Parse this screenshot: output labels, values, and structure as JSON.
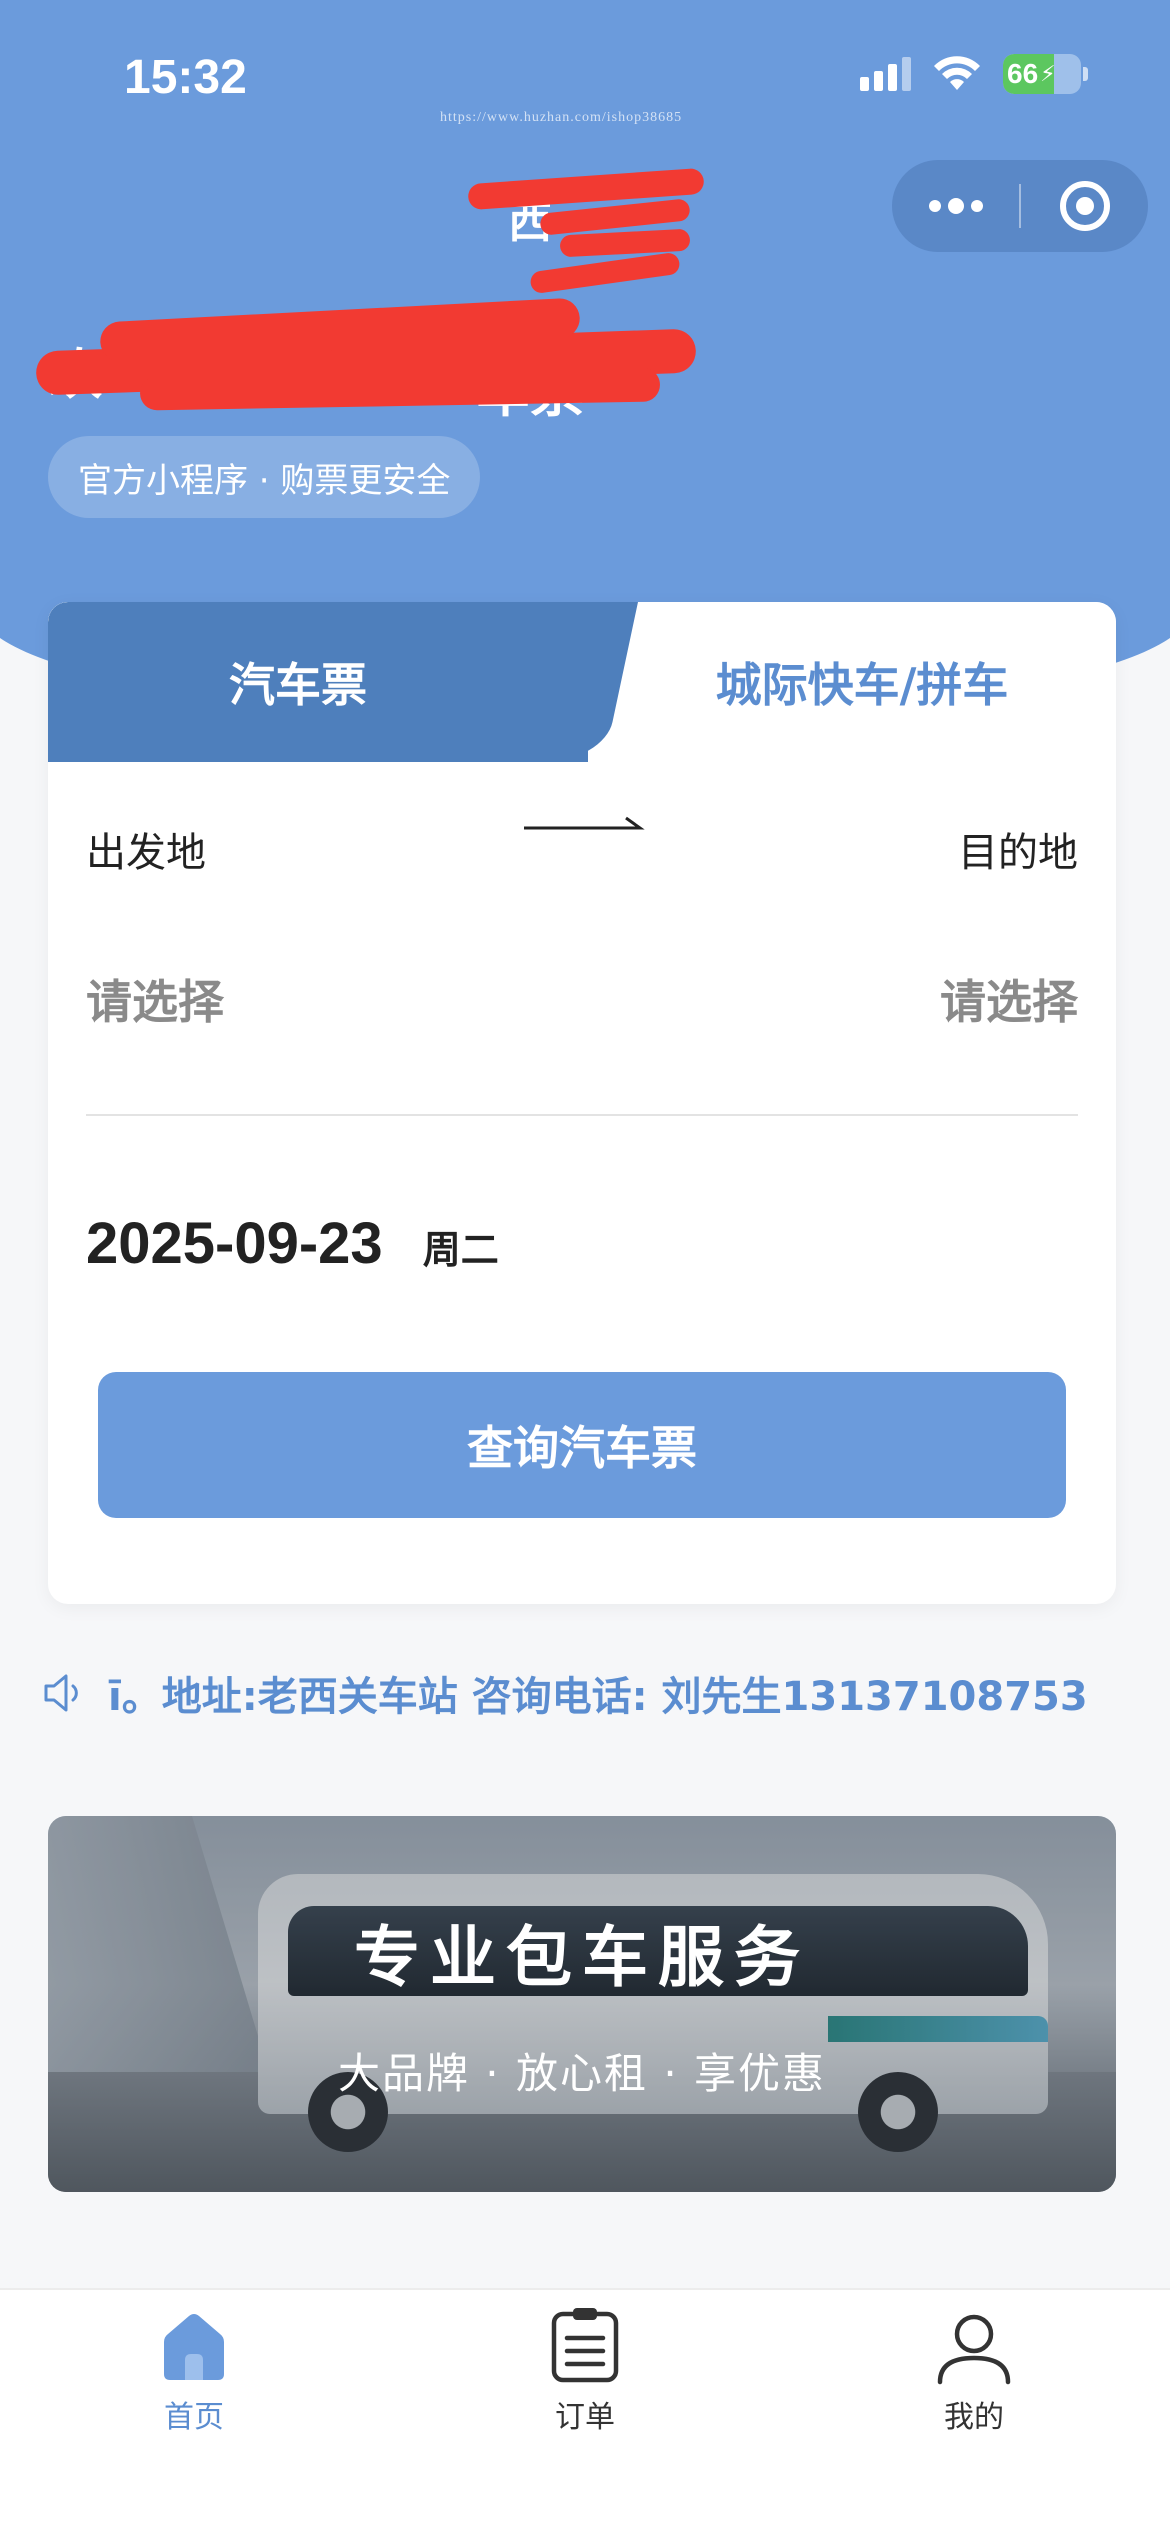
{
  "status_bar": {
    "time": "15:32",
    "battery": "66"
  },
  "watermark": "https://www.huzhan.com/ishop38685",
  "header": {
    "title_visible_fragment": "西",
    "headline_visible_tail": "车票",
    "slogan": "官方小程序 · 购票更安全"
  },
  "booking": {
    "tabs": [
      {
        "label": "汽车票",
        "active": true
      },
      {
        "label": "城际快车/拼车",
        "active": false
      }
    ],
    "origin_label": "出发地",
    "destination_label": "目的地",
    "origin_value": "请选择",
    "destination_value": "请选择",
    "date": "2025-09-23",
    "weekday": "周二",
    "search_button": "查询汽车票"
  },
  "notice": {
    "icon": "speaker-icon",
    "text": "ī。地址:老西关车站 咨询电话: 刘先生13137108753"
  },
  "banner": {
    "title": "专业包车服务",
    "subtitle": "大品牌 · 放心租 · 享优惠"
  },
  "tabbar": [
    {
      "label": "首页",
      "icon": "home-icon",
      "active": true
    },
    {
      "label": "订单",
      "icon": "order-clipboard-icon",
      "active": false
    },
    {
      "label": "我的",
      "icon": "profile-icon",
      "active": false
    }
  ],
  "colors": {
    "primary": "#6b9bdc",
    "tab_active": "#4e7fbc",
    "accent_text": "#5b8dd0",
    "redaction": "#f23a32"
  }
}
